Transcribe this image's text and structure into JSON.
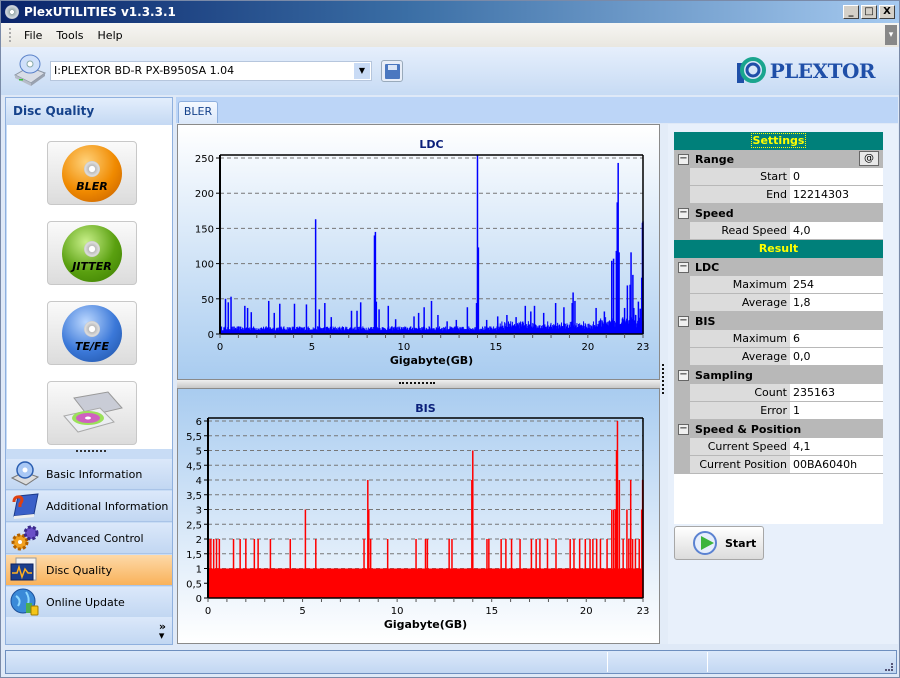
{
  "window": {
    "title": "PlexUTILITIES v1.3.3.1",
    "controls": {
      "minimize": "_",
      "maximize": "□",
      "close": "X"
    }
  },
  "menu": {
    "items": [
      "File",
      "Tools",
      "Help"
    ]
  },
  "toolbar": {
    "drive_select_value": "I:PLEXTOR BD-R  PX-B950SA  1.04",
    "save_icon": "floppy-save-icon",
    "logo_text": "PLEXTOR"
  },
  "left_panel": {
    "header": "Disc Quality",
    "quality_buttons": [
      {
        "label": "BLER",
        "color": "#f08a00"
      },
      {
        "label": "JITTER",
        "color": "#5aa010"
      },
      {
        "label": "TE/FE",
        "color": "#3b78d8"
      },
      {
        "label": "",
        "icon": "drive-tray-icon"
      }
    ],
    "nav_items": [
      {
        "label": "Basic Information",
        "icon": "disc-drive-icon",
        "active": false
      },
      {
        "label": "Additional Information",
        "icon": "book-question-icon",
        "active": false
      },
      {
        "label": "Advanced Control",
        "icon": "gears-icon",
        "active": false
      },
      {
        "label": "Disc Quality",
        "icon": "waveform-monitor-icon",
        "active": true
      },
      {
        "label": "Online Update",
        "icon": "globe-update-icon",
        "active": false
      }
    ],
    "more_glyph": "»"
  },
  "tabs": [
    {
      "label": "BLER",
      "active": true
    }
  ],
  "chart_data": [
    {
      "type": "bar",
      "title": "LDC",
      "xlabel": "Gigabyte(GB)",
      "ylabel": "",
      "xlim": [
        0,
        23
      ],
      "ylim": [
        0,
        250
      ],
      "xticks": [
        0,
        5,
        10,
        15,
        20,
        23
      ],
      "yticks": [
        0,
        50,
        100,
        150,
        200,
        250
      ],
      "grid": true,
      "color": "#0000ff",
      "max": 254,
      "baseline_approx": 5,
      "peaks": [
        [
          0.3,
          50
        ],
        [
          0.45,
          45
        ],
        [
          0.6,
          53
        ],
        [
          1.35,
          40
        ],
        [
          1.5,
          37
        ],
        [
          1.7,
          31
        ],
        [
          2.65,
          47
        ],
        [
          2.95,
          30
        ],
        [
          3.25,
          43
        ],
        [
          4.05,
          43
        ],
        [
          4.7,
          42
        ],
        [
          5.2,
          163
        ],
        [
          5.4,
          35
        ],
        [
          5.7,
          44
        ],
        [
          6.05,
          24
        ],
        [
          7.15,
          33
        ],
        [
          7.45,
          33
        ],
        [
          7.65,
          45
        ],
        [
          8.4,
          140
        ],
        [
          8.45,
          145
        ],
        [
          8.5,
          46
        ],
        [
          8.65,
          35
        ],
        [
          9.15,
          40
        ],
        [
          9.55,
          21
        ],
        [
          10.55,
          25
        ],
        [
          10.8,
          30
        ],
        [
          11.1,
          38
        ],
        [
          11.5,
          47
        ],
        [
          11.85,
          27
        ],
        [
          12.35,
          18
        ],
        [
          12.85,
          20
        ],
        [
          13.45,
          38
        ],
        [
          13.95,
          44
        ],
        [
          14.0,
          254
        ],
        [
          14.05,
          123
        ],
        [
          14.5,
          20
        ],
        [
          15.1,
          25
        ],
        [
          15.6,
          27
        ],
        [
          16.1,
          24
        ],
        [
          16.6,
          40
        ],
        [
          16.9,
          32
        ],
        [
          17.1,
          40
        ],
        [
          17.6,
          30
        ],
        [
          18.25,
          44
        ],
        [
          18.7,
          38
        ],
        [
          19.15,
          44
        ],
        [
          19.2,
          59
        ],
        [
          19.3,
          47
        ],
        [
          20.45,
          37
        ],
        [
          20.9,
          32
        ],
        [
          21.3,
          104
        ],
        [
          21.4,
          107
        ],
        [
          21.55,
          118
        ],
        [
          21.6,
          187
        ],
        [
          21.65,
          243
        ],
        [
          21.7,
          116
        ],
        [
          22.0,
          37
        ],
        [
          22.15,
          69
        ],
        [
          22.3,
          70
        ],
        [
          22.35,
          116
        ],
        [
          22.45,
          84
        ],
        [
          22.5,
          37
        ],
        [
          22.75,
          46
        ],
        [
          22.85,
          36
        ],
        [
          22.93,
          80
        ],
        [
          22.97,
          158
        ],
        [
          23.0,
          160
        ]
      ]
    },
    {
      "type": "bar",
      "title": "BIS",
      "xlabel": "Gigabyte(GB)",
      "ylabel": "",
      "xlim": [
        0,
        23
      ],
      "ylim": [
        0,
        6
      ],
      "xticks": [
        0,
        5,
        10,
        15,
        20,
        23
      ],
      "yticks": [
        "0",
        "0,5",
        "1",
        "1,5",
        "2",
        "2,5",
        "3",
        "3,5",
        "4",
        "4,5",
        "5",
        "5,5",
        "6"
      ],
      "grid": true,
      "color": "#ff0000",
      "max": 6,
      "baseline": 1,
      "peaks": [
        [
          0.05,
          2
        ],
        [
          0.15,
          2
        ],
        [
          0.3,
          2
        ],
        [
          0.45,
          2
        ],
        [
          0.6,
          2
        ],
        [
          1.35,
          2
        ],
        [
          1.7,
          2
        ],
        [
          2.0,
          2
        ],
        [
          2.45,
          2
        ],
        [
          2.65,
          2
        ],
        [
          3.3,
          2
        ],
        [
          4.35,
          2
        ],
        [
          5.15,
          3
        ],
        [
          5.7,
          2
        ],
        [
          8.25,
          2
        ],
        [
          8.45,
          4
        ],
        [
          8.5,
          3
        ],
        [
          8.6,
          2
        ],
        [
          9.5,
          2
        ],
        [
          11.0,
          2
        ],
        [
          11.5,
          2
        ],
        [
          11.6,
          2
        ],
        [
          12.75,
          2
        ],
        [
          12.9,
          2
        ],
        [
          13.95,
          4
        ],
        [
          14.0,
          5
        ],
        [
          14.75,
          2
        ],
        [
          14.85,
          2
        ],
        [
          15.5,
          2
        ],
        [
          15.75,
          2
        ],
        [
          16.05,
          2
        ],
        [
          16.5,
          2
        ],
        [
          17.1,
          2
        ],
        [
          17.35,
          2
        ],
        [
          17.55,
          2
        ],
        [
          17.95,
          2
        ],
        [
          18.4,
          2
        ],
        [
          19.15,
          2
        ],
        [
          19.35,
          2
        ],
        [
          19.65,
          2
        ],
        [
          19.95,
          2
        ],
        [
          20.2,
          2
        ],
        [
          20.35,
          2
        ],
        [
          20.55,
          2
        ],
        [
          20.75,
          2
        ],
        [
          21.1,
          2
        ],
        [
          21.35,
          3
        ],
        [
          21.45,
          3
        ],
        [
          21.55,
          3
        ],
        [
          21.6,
          5
        ],
        [
          21.65,
          6
        ],
        [
          21.75,
          4
        ],
        [
          21.95,
          2
        ],
        [
          22.15,
          3
        ],
        [
          22.25,
          2
        ],
        [
          22.35,
          4
        ],
        [
          22.45,
          2
        ],
        [
          22.6,
          2
        ],
        [
          22.8,
          2
        ],
        [
          22.93,
          3
        ],
        [
          22.98,
          4
        ],
        [
          23.0,
          4
        ]
      ]
    }
  ],
  "settings": {
    "header": "Settings",
    "range": {
      "label": "Range",
      "button": "@",
      "start_label": "Start",
      "start": "0",
      "end_label": "End",
      "end": "12214303"
    },
    "speed": {
      "label": "Speed",
      "read_speed_label": "Read Speed",
      "read_speed": "4,0"
    }
  },
  "result": {
    "header": "Result",
    "ldc": {
      "label": "LDC",
      "max_label": "Maximum",
      "max": "254",
      "avg_label": "Average",
      "avg": "1,8"
    },
    "bis": {
      "label": "BIS",
      "max_label": "Maximum",
      "max": "6",
      "avg_label": "Average",
      "avg": "0,0"
    },
    "sampling": {
      "label": "Sampling",
      "count_label": "Count",
      "count": "235163",
      "error_label": "Error",
      "error": "1"
    },
    "speed_position": {
      "label": "Speed & Position",
      "speed_label": "Current Speed",
      "speed": "4,1",
      "pos_label": "Current Position",
      "pos": "00BA6040h"
    }
  },
  "actions": {
    "start_label": "Start"
  }
}
